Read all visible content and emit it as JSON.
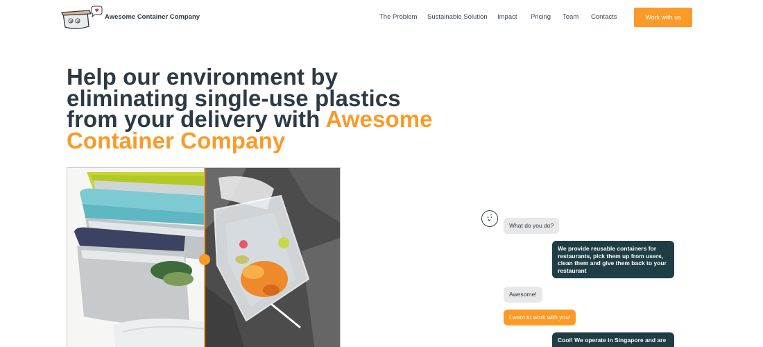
{
  "header": {
    "brand_name": "Awesome Container Company",
    "nav": [
      {
        "label": "The Problem"
      },
      {
        "label": "Sustainable Solution"
      },
      {
        "label": "Impact"
      },
      {
        "label": "Pricing"
      },
      {
        "label": "Team"
      },
      {
        "label": "Contacts"
      }
    ],
    "cta_label": "Work with us"
  },
  "hero": {
    "title_part1": "Help our environment by eliminating single-use plastics from your delivery with ",
    "title_accent": "Awesome Container Company"
  },
  "chat": {
    "messages": [
      {
        "text": "What do you do?"
      },
      {
        "text": "We provide reusable containers for restaurants, pick them up from users, clean them and give them back to your restaurant"
      },
      {
        "text": "Awesome!"
      },
      {
        "text": "I want to work with you!"
      },
      {
        "text": "Cool! We operate in Singapore and are"
      }
    ]
  },
  "colors": {
    "accent": "#fb9a28",
    "dark_bubble": "#1f3d44",
    "grey_bubble": "#e8e8e8",
    "text": "#2d3a44"
  },
  "icons": {
    "logo": "container-mascot-logo",
    "chat_avatar": "smiley-face-icon",
    "compare_handle": "slider-handle-icon"
  }
}
